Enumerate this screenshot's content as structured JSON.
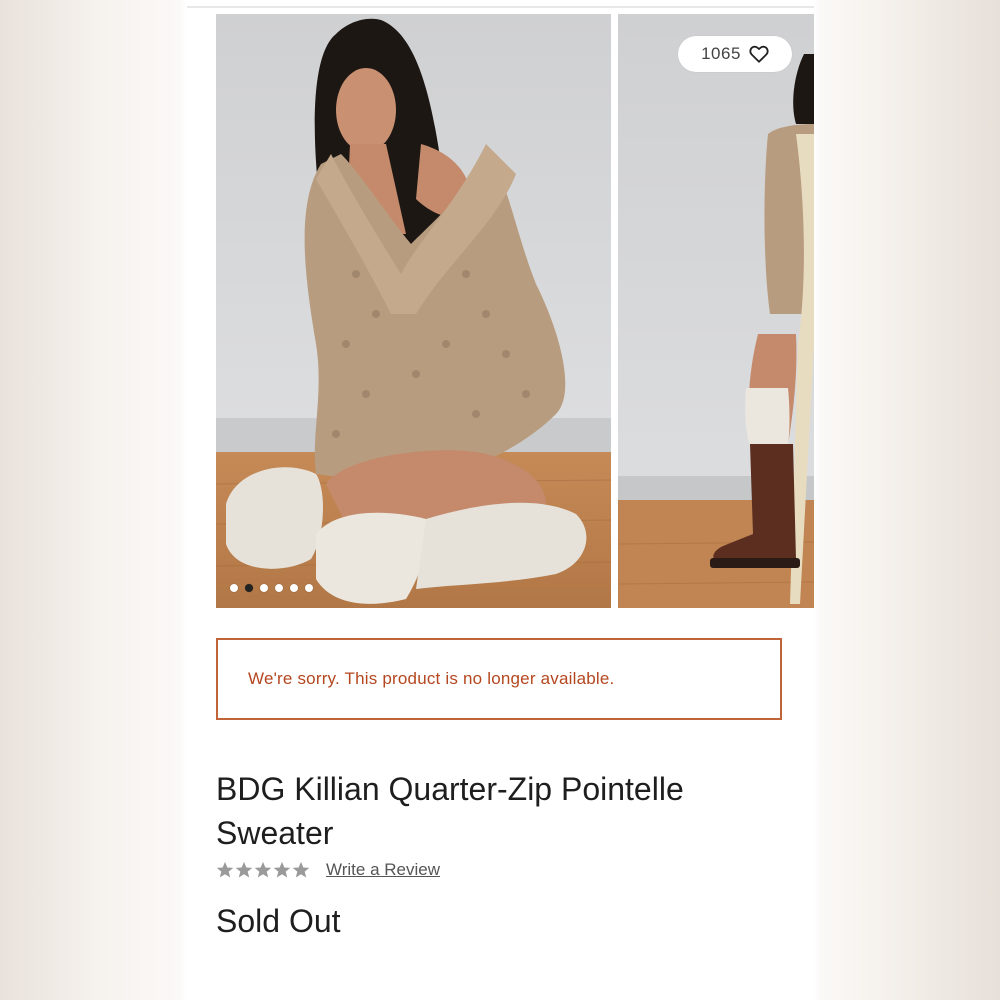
{
  "gallery": {
    "favorites_count": "1065",
    "favorite_icon": "heart-icon",
    "slide_count": 6,
    "active_slide": 1
  },
  "notice": {
    "message": "We're sorry. This product is no longer available.",
    "border_color": "#c0643a",
    "text_color": "#b4471f"
  },
  "product": {
    "name": "BDG Killian Quarter-Zip Pointelle Sweater",
    "rating_out_of_5": 0,
    "review_link": "Write a Review",
    "status": "Sold Out"
  }
}
